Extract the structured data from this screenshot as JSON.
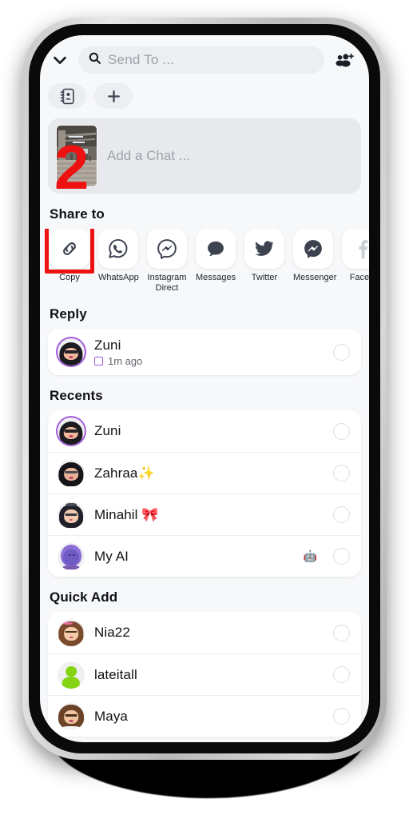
{
  "app": {
    "name": "snapchat-send-to"
  },
  "header": {
    "collapse_icon": "chevron-down-icon",
    "search_icon": "search-icon",
    "search_placeholder": "Send To ...",
    "group_add_icon": "group-add-icon"
  },
  "quick_actions": [
    {
      "name": "address-book",
      "icon": "address-book-icon"
    },
    {
      "name": "new-group",
      "icon": "plus-icon"
    }
  ],
  "composer": {
    "placeholder": "Add a Chat ...",
    "thumbnail_alt": "snap-preview-thumbnail"
  },
  "annotation": {
    "step_number": "2",
    "color": "#ee1111"
  },
  "share": {
    "label": "Share to",
    "highlighted": "Copy",
    "items": [
      {
        "label": "Copy",
        "icon": "link-icon",
        "highlighted": true
      },
      {
        "label": "WhatsApp",
        "icon": "whatsapp-icon",
        "highlighted": false
      },
      {
        "label": "Instagram Direct",
        "icon": "instagram-direct-icon",
        "highlighted": false
      },
      {
        "label": "Messages",
        "icon": "messages-bubble-icon",
        "highlighted": false
      },
      {
        "label": "Twitter",
        "icon": "twitter-bird-icon",
        "highlighted": false
      },
      {
        "label": "Messenger",
        "icon": "messenger-icon",
        "highlighted": false
      },
      {
        "label": "Faceb",
        "icon": "facebook-icon",
        "highlighted": false
      }
    ]
  },
  "reply": {
    "label": "Reply",
    "items": [
      {
        "name": "Zuni",
        "status_text": "1m ago",
        "status_icon": "chat-square-icon",
        "avatar": "bitmoji-zuni",
        "selected": false
      }
    ]
  },
  "recents": {
    "label": "Recents",
    "items": [
      {
        "name": "Zuni",
        "avatar": "bitmoji-zuni",
        "badge": "",
        "selected": false
      },
      {
        "name": "Zahraa✨",
        "avatar": "bitmoji-zahraa",
        "badge": "",
        "selected": false
      },
      {
        "name": "Minahil 🎀",
        "avatar": "bitmoji-minahil",
        "badge": "",
        "selected": false
      },
      {
        "name": "My AI",
        "avatar": "bitmoji-myai",
        "badge": "🤖",
        "selected": false
      }
    ]
  },
  "quick_add": {
    "label": "Quick Add",
    "items": [
      {
        "name": "Nia22",
        "avatar": "bitmoji-nia22",
        "badge": "",
        "selected": false
      },
      {
        "name": "lateitall",
        "avatar": "default-ghost-avatar",
        "badge": "",
        "selected": false
      },
      {
        "name": "Maya",
        "avatar": "bitmoji-maya",
        "badge": "",
        "selected": false
      }
    ]
  },
  "colors": {
    "accent_purple": "#a35ddb",
    "annotation_red": "#ee1111",
    "app_background": "#f7f8fa",
    "card_white": "#ffffff"
  }
}
